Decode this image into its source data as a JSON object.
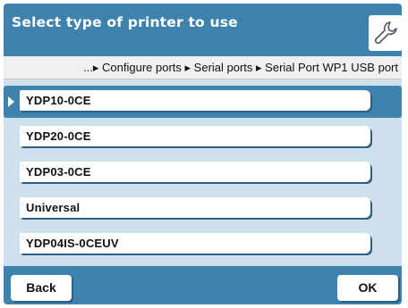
{
  "header": {
    "title": "Select type of printer to use",
    "tool_icon": "wrench-icon"
  },
  "breadcrumb": {
    "text": "...▸ Configure ports ▸ Serial ports ▸ Serial Port WP1 USB port"
  },
  "list": {
    "selected_index": 0,
    "items": [
      {
        "label": "YDP10-0CE"
      },
      {
        "label": "YDP20-0CE"
      },
      {
        "label": "YDP03-0CE"
      },
      {
        "label": "Universal"
      },
      {
        "label": "YDP04IS-0CEUV"
      }
    ]
  },
  "footer": {
    "back_label": "Back",
    "ok_label": "OK"
  },
  "colors": {
    "accent": "#3f82ad",
    "list_bg": "#cfe1ec"
  }
}
